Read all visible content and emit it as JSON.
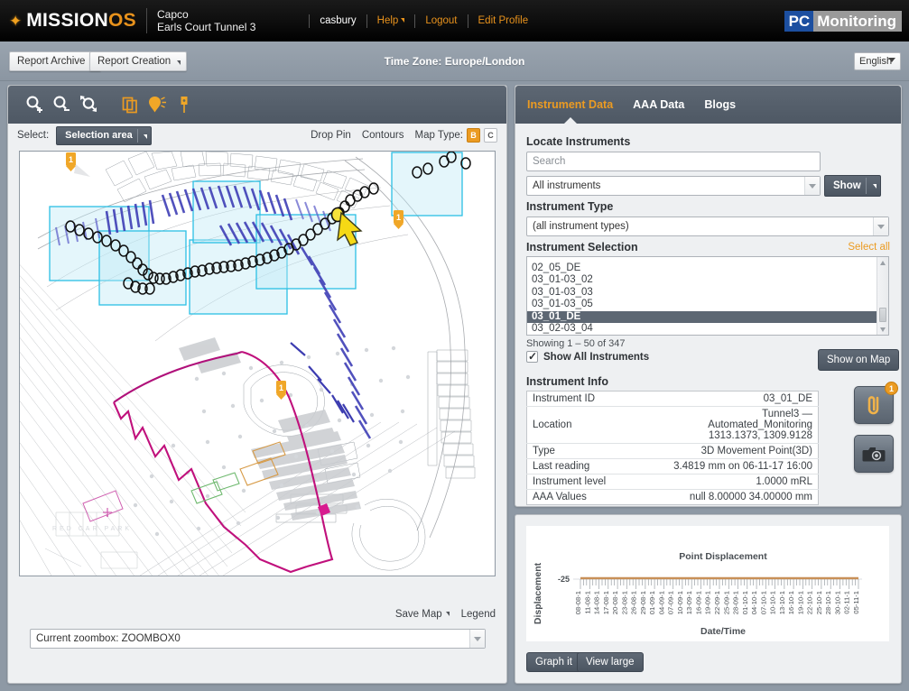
{
  "header": {
    "brand_main": "MISSION",
    "brand_accent": "OS",
    "star_icon": "star-icon",
    "project_company": "Capco",
    "project_name": "Earls Court Tunnel 3",
    "username": "casbury",
    "help_label": "Help",
    "logout_label": "Logout",
    "edit_profile_label": "Edit Profile",
    "logo_left": "PC",
    "logo_right": "Monitoring",
    "accent_color": "#e8921c",
    "logo_blue": "#1c4fa0"
  },
  "menubar": {
    "report_archive_label": "Report Archive",
    "report_creation_label": "Report Creation",
    "timezone_label": "Time Zone: Europe/London",
    "language_value": "English"
  },
  "map": {
    "toolbar_icons": [
      "zoom-in-icon",
      "zoom-out-icon",
      "zoom-extent-icon",
      "layers-icon",
      "highlight-marker-icon",
      "pin-icon"
    ],
    "select_label": "Select:",
    "selection_area_value": "Selection area",
    "drop_pin_label": "Drop Pin",
    "contours_label": "Contours",
    "map_type_label": "Map Type:",
    "map_type_options": [
      "B",
      "C"
    ],
    "map_type_active": "B",
    "save_map_label": "Save Map",
    "legend_label": "Legend",
    "zoombox_value": "Current zoombox: ZOOMBOX0",
    "marker_badges": [
      "1",
      "1",
      "1"
    ]
  },
  "panel": {
    "tabs": [
      {
        "label": "Instrument Data",
        "active": true
      },
      {
        "label": "AAA Data",
        "active": false
      },
      {
        "label": "Blogs",
        "active": false
      }
    ],
    "locate_heading": "Locate Instruments",
    "search_placeholder": "Search",
    "filter_value": "All instruments",
    "show_button_label": "Show",
    "instrument_type_heading": "Instrument Type",
    "instrument_type_value": "(all instrument types)",
    "instrument_selection_heading": "Instrument Selection",
    "select_all_label": "Select all",
    "instrument_list": [
      "02_05_DE",
      "03_01-03_02",
      "03_01-03_03",
      "03_01-03_05",
      "03_01_DE",
      "03_02-03_04"
    ],
    "instrument_selected": "03_01_DE",
    "showing_label": "Showing 1 – 50 of 347",
    "show_all_label": "Show All Instruments",
    "show_on_map_label": "Show on Map",
    "instrument_info_heading": "Instrument Info",
    "info_rows": [
      {
        "key": "Instrument ID",
        "value": "03_01_DE",
        "value2": ""
      },
      {
        "key": "Location",
        "value": "Tunnel3 — Automated_Monitoring",
        "value2": "1313.1373, 1309.9128"
      },
      {
        "key": "Type",
        "value": "3D Movement Point(3D)",
        "value2": ""
      },
      {
        "key": "Last reading",
        "value": "3.4819 mm on 06-11-17 16:00",
        "value2": ""
      },
      {
        "key": "Instrument level",
        "value": "1.0000 mRL",
        "value2": ""
      },
      {
        "key": "AAA Values",
        "value": "null 8.00000 34.00000 mm",
        "value2": ""
      }
    ],
    "attachment_icon": "paperclip-icon",
    "attachment_badge": "1",
    "photo_icon": "camera-icon"
  },
  "chart_panel": {
    "graph_it_label": "Graph it",
    "view_large_label": "View large"
  },
  "chart_data": {
    "type": "line",
    "title": "Point Displacement",
    "xlabel": "Date/Time",
    "ylabel": "Displacement",
    "ytick_labels": [
      "-25"
    ],
    "ylim": [
      -25,
      -25
    ],
    "grid": false,
    "legend": "none",
    "series_color": "#c89058",
    "x": [
      "08-08-1",
      "11-08-1",
      "14-08-1",
      "17-08-1",
      "20-08-1",
      "23-08-1",
      "26-08-1",
      "29-08-1",
      "01-09-1",
      "04-09-1",
      "07-09-1",
      "10-09-1",
      "13-09-1",
      "16-09-1",
      "19-09-1",
      "22-09-1",
      "25-09-1",
      "28-09-1",
      "01-10-1",
      "04-10-1",
      "07-10-1",
      "10-10-1",
      "13-10-1",
      "16-10-1",
      "19-10-1",
      "22-10-1",
      "25-10-1",
      "28-10-1",
      "30-10-1",
      "02-11-1",
      "05-11-1"
    ],
    "series": [
      {
        "name": "Displacement",
        "values": [
          -25,
          -25,
          -25,
          -25,
          -25,
          -25,
          -25,
          -25,
          -25,
          -25,
          -25,
          -25,
          -25,
          -25,
          -25,
          -25,
          -25,
          -25,
          -25,
          -25,
          -25,
          -25,
          -25,
          -25,
          -25,
          -25,
          -25,
          -25,
          -25,
          -25,
          -25
        ]
      }
    ]
  }
}
